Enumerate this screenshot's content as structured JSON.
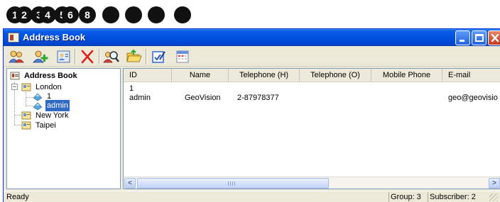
{
  "callouts": [
    "1",
    "2",
    "3",
    "4",
    "5",
    "6",
    "",
    "8",
    "",
    "",
    "",
    ""
  ],
  "window": {
    "title": "Address Book"
  },
  "titlebar_buttons": [
    "minimize-icon",
    "maximize-icon",
    "close-icon"
  ],
  "toolbar": {
    "tools": [
      {
        "icon": "group-users-icon"
      },
      {
        "icon": "add-user-icon"
      },
      {
        "icon": "address-card-icon"
      },
      {
        "icon": "delete-x-icon"
      },
      {
        "icon": "find-user-icon"
      },
      {
        "icon": "folder-open-icon"
      },
      {
        "icon": "edit-checklist-icon"
      },
      {
        "icon": "calendar-window-icon"
      }
    ]
  },
  "tree": {
    "root": "Address Book",
    "groups": [
      {
        "label": "London",
        "children": [
          "1",
          "admin"
        ]
      },
      {
        "label": "New York"
      },
      {
        "label": "Taipei"
      }
    ]
  },
  "list": {
    "columns": [
      "ID",
      "Name",
      "Telephone (H)",
      "Telephone (O)",
      "Mobile Phone",
      "E-mail"
    ],
    "rows": [
      [
        "1",
        "",
        "",
        "",
        "",
        ""
      ],
      [
        "admin",
        "GeoVision",
        "2-87978377",
        "",
        "",
        "geo@geovisio"
      ]
    ]
  },
  "scrollbar": {
    "left_arrow": "<",
    "right_arrow": ">"
  },
  "status": {
    "ready": "Ready",
    "group": "Group: 3",
    "subscriber": "Subscriber: 2"
  },
  "colors": {
    "titlebar": "#0050e0",
    "selection": "#316ac5",
    "callout": "#111111"
  }
}
